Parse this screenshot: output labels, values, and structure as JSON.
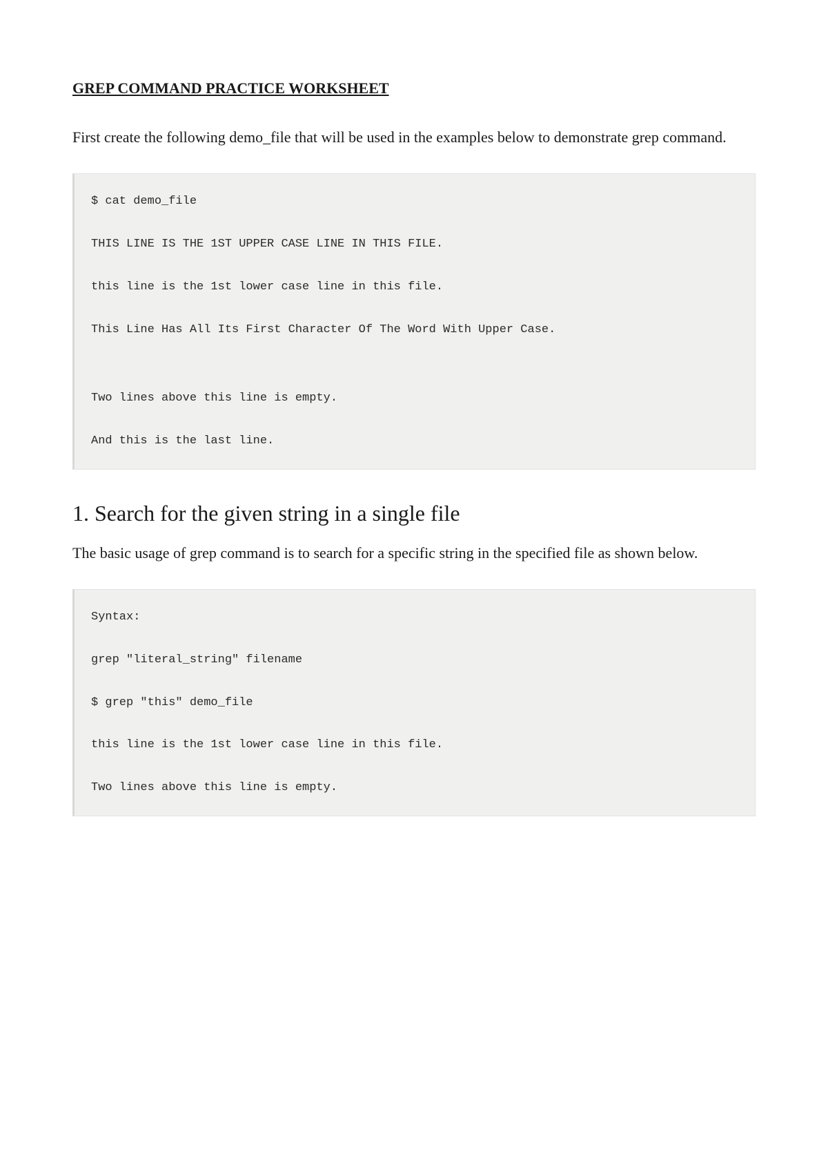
{
  "title": "GREP COMMAND PRACTICE WORKSHEET",
  "intro": "First create the following demo_file that will be used in the examples below to demonstrate grep command.",
  "codeblock1": {
    "l1": "$ cat demo_file",
    "l2": "THIS LINE IS THE 1ST UPPER CASE LINE IN THIS FILE.",
    "l3": "this line is the 1st lower case line in this file.",
    "l4": "This Line Has All Its First Character Of The Word With Upper Case.",
    "l5": "Two lines above this line is empty.",
    "l6": "And this is the last line."
  },
  "section1": {
    "heading": "1. Search for the given string in a single file",
    "body": "The basic usage of grep command is to search for a specific string in the specified file as shown below."
  },
  "codeblock2": {
    "l1": "Syntax:",
    "l2": "grep \"literal_string\" filename",
    "l3": "$ grep \"this\" demo_file",
    "l4": "this line is the 1st lower case line in this file.",
    "l5": "Two lines above this line is empty."
  }
}
